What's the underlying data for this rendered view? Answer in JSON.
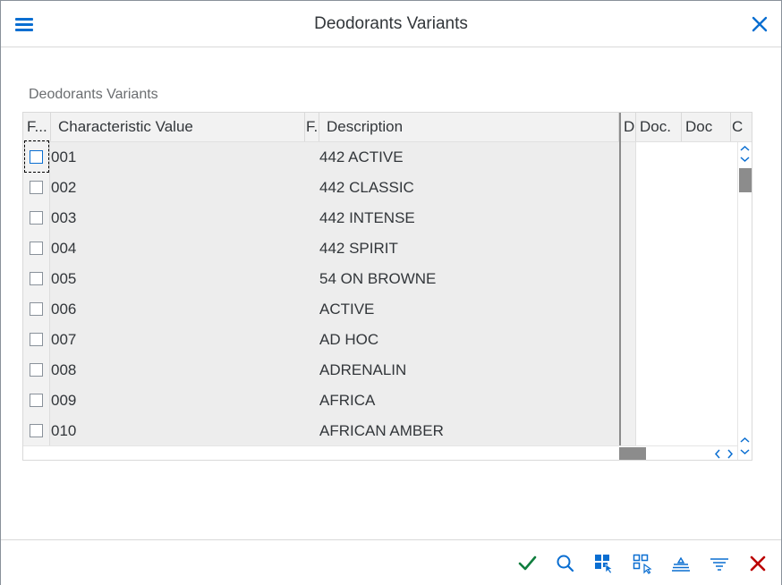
{
  "window": {
    "title": "Deodorants Variants"
  },
  "table": {
    "caption": "Deodorants Variants",
    "headers": {
      "sel": "F...",
      "value": "Characteristic Value",
      "flag": "F.",
      "description": "Description",
      "d": "D",
      "doc1": "Doc.",
      "doc2": "Doc",
      "c": "C"
    },
    "rows": [
      {
        "value": "001",
        "description": "442 ACTIVE"
      },
      {
        "value": "002",
        "description": "442 CLASSIC"
      },
      {
        "value": "003",
        "description": "442 INTENSE"
      },
      {
        "value": "004",
        "description": "442 SPIRIT"
      },
      {
        "value": "005",
        "description": "54 ON BROWNE"
      },
      {
        "value": "006",
        "description": "ACTIVE"
      },
      {
        "value": "007",
        "description": "AD HOC"
      },
      {
        "value": "008",
        "description": "ADRENALIN"
      },
      {
        "value": "009",
        "description": "AFRICA"
      },
      {
        "value": "010",
        "description": "AFRICAN AMBER"
      }
    ]
  },
  "colors": {
    "accent": "#0a6ed1",
    "confirm": "#107e3e",
    "cancel": "#bb0000"
  },
  "icons": {
    "menu": "hamburger-icon",
    "close": "close-icon",
    "confirm": "checkmark-icon",
    "search": "search-icon",
    "select_all": "select-all-icon",
    "deselect_all": "deselect-all-icon",
    "sort": "sort-icon",
    "filter": "filter-icon",
    "cancel": "cancel-icon"
  }
}
